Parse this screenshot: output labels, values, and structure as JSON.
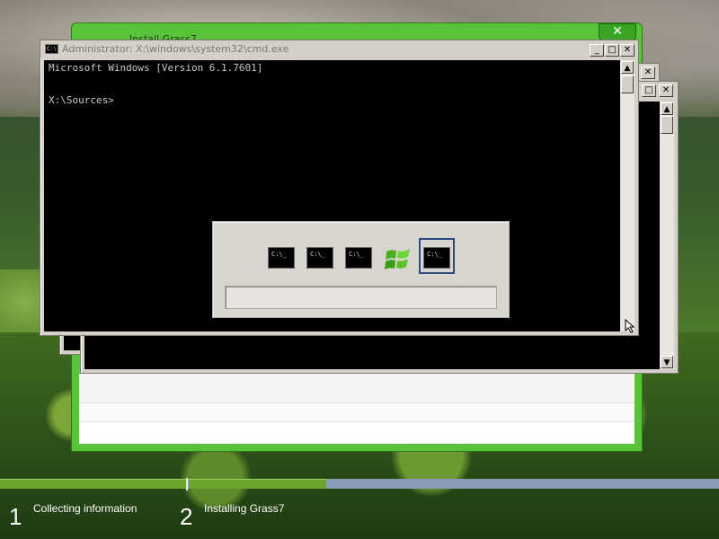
{
  "setup_window": {
    "title": "Install Grass7",
    "close_glyph": "✕"
  },
  "cmd_window": {
    "title": "Administrator: X:\\windows\\system32\\cmd.exe",
    "icon_text": "C:\\",
    "lines": [
      "Microsoft Windows [Version 6.1.7601]",
      "",
      "X:\\Sources>"
    ]
  },
  "window_buttons": {
    "minimize": "_",
    "maximize": "□",
    "close": "✕"
  },
  "scroll_buttons": {
    "up": "▲",
    "down": "▼"
  },
  "switcher": {
    "items": [
      {
        "type": "cmd",
        "label": "C:\\_"
      },
      {
        "type": "cmd",
        "label": "C:\\_"
      },
      {
        "type": "cmd",
        "label": "C:\\_"
      },
      {
        "type": "windows-logo",
        "label": ""
      },
      {
        "type": "cmd",
        "label": "C:\\_",
        "selected": true
      }
    ]
  },
  "steps": [
    {
      "number": "1",
      "label": "Collecting information",
      "progress": 1.0
    },
    {
      "number": "2",
      "label": "Installing Grass7",
      "progress": 0.26
    }
  ],
  "colors": {
    "setup_frame": "#58c33a",
    "progress_done": "#6aa42c",
    "progress_remaining": "#8a9bb6",
    "switcher_selection": "#2b4b88"
  }
}
